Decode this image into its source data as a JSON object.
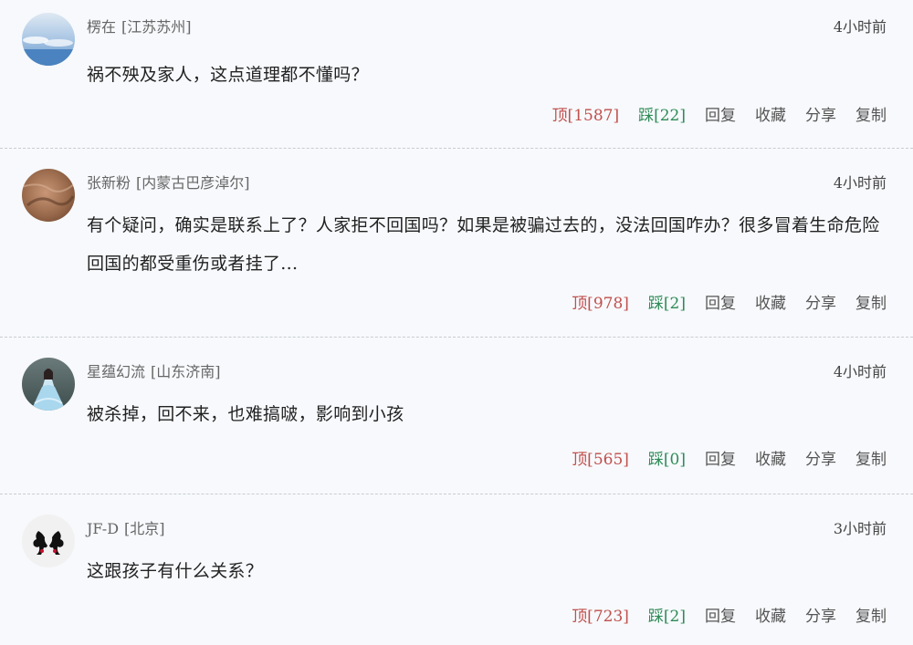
{
  "comments": [
    {
      "user": "楞在",
      "location": "[江苏苏州]",
      "time": "4小时前",
      "text": "祸不殃及家人，这点道理都不懂吗？",
      "up": "顶[1587]",
      "down": "踩[22]",
      "reply": "回复",
      "fav": "收藏",
      "share": "分享",
      "copy": "复制",
      "avatar_icon": "sky-clouds-avatar-icon"
    },
    {
      "user": "张新粉",
      "location": "[内蒙古巴彦淖尔]",
      "time": "4小时前",
      "text": "有个疑问，确实是联系上了？人家拒不回国吗？如果是被骗过去的，没法回国咋办？很多冒着生命危险回国的都受重伤或者挂了...",
      "up": "顶[978]",
      "down": "踩[2]",
      "reply": "回复",
      "fav": "收藏",
      "share": "分享",
      "copy": "复制",
      "avatar_icon": "brown-texture-avatar-icon"
    },
    {
      "user": "星蕴幻流",
      "location": "[山东济南]",
      "time": "4小时前",
      "text": "被杀掉，回不来，也难搞啵，影响到小孩",
      "up": "顶[565]",
      "down": "踩[0]",
      "reply": "回复",
      "fav": "收藏",
      "share": "分享",
      "copy": "复制",
      "avatar_icon": "woman-in-dress-avatar-icon"
    },
    {
      "user": "JF-D",
      "location": "[北京]",
      "time": "3小时前",
      "text": "这跟孩子有什么关系？",
      "up": "顶[723]",
      "down": "踩[2]",
      "reply": "回复",
      "fav": "收藏",
      "share": "分享",
      "copy": "复制",
      "avatar_icon": "ink-figures-avatar-icon"
    }
  ],
  "colors": {
    "background": "#f7f9fc",
    "up": "#c0504d",
    "down": "#2e8b57"
  }
}
